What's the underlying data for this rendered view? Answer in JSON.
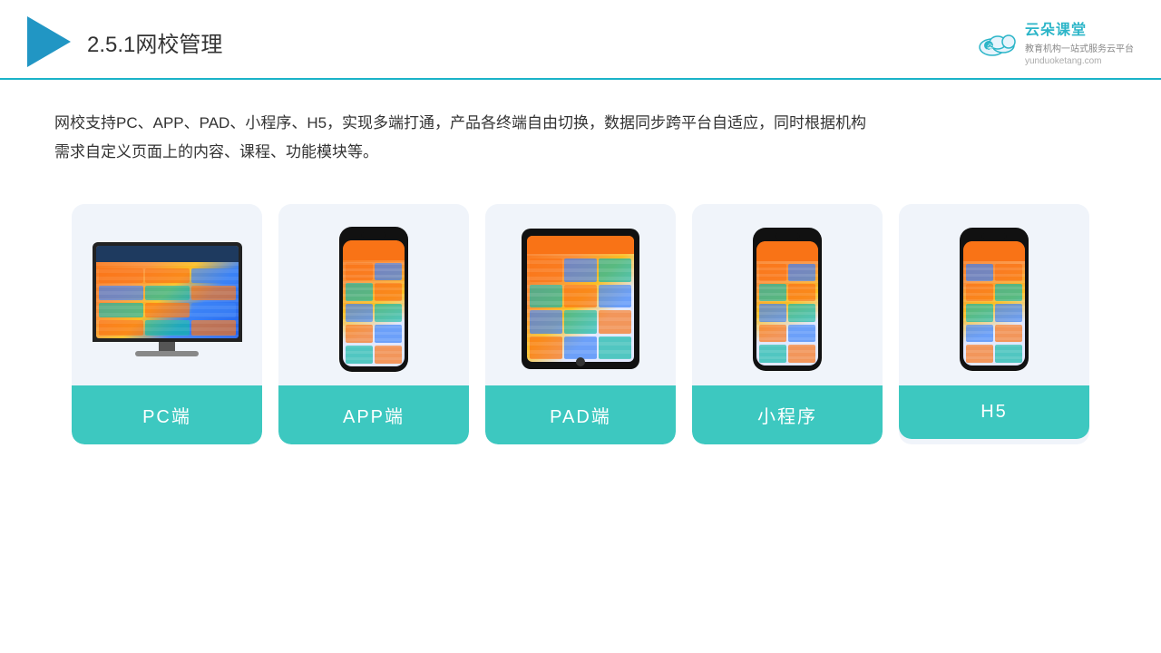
{
  "header": {
    "title_prefix": "2.5.1",
    "title_main": "网校管理",
    "brand_name": "云朵课堂",
    "brand_url": "yunduoketang.com",
    "brand_slogan": "教育机构一站\n式服务云平台"
  },
  "description": {
    "text": "网校支持PC、APP、PAD、小程序、H5，实现多端打通，产品各终端自由切换，数据同步跨平台自适应，同时根据机构需求自定义页面上的内容、课程、功能模块等。"
  },
  "cards": [
    {
      "id": "pc",
      "label": "PC端"
    },
    {
      "id": "app",
      "label": "APP端"
    },
    {
      "id": "pad",
      "label": "PAD端"
    },
    {
      "id": "miniapp",
      "label": "小程序"
    },
    {
      "id": "h5",
      "label": "H5"
    }
  ]
}
